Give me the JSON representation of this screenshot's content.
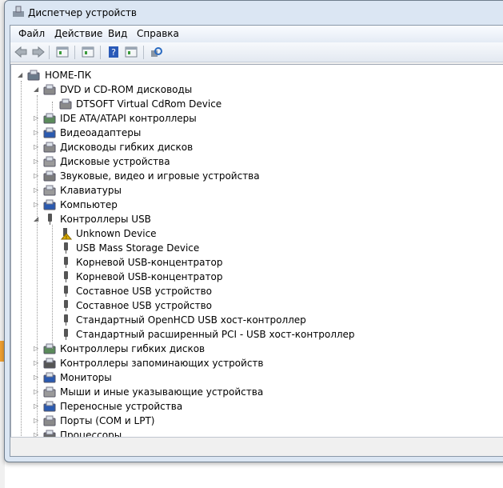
{
  "window": {
    "title": "Диспетчер устройств"
  },
  "menu": [
    "Файл",
    "Действие",
    "Вид",
    "Справка"
  ],
  "toolbar": [
    {
      "icon": "back-arrow-icon"
    },
    {
      "icon": "forward-arrow-icon"
    },
    {
      "icon": "show-hide-console-tree-icon"
    },
    {
      "icon": "properties-icon"
    },
    {
      "icon": "help-icon"
    },
    {
      "icon": "action-pane-icon"
    },
    {
      "icon": "scan-hardware-icon"
    }
  ],
  "tree": [
    {
      "label": "HOME-ПК",
      "level": 0,
      "expanded": true,
      "icon": "computer-icon",
      "color": "#6a7a8a"
    },
    {
      "label": "DVD и CD-ROM дисководы",
      "level": 1,
      "expanded": true,
      "icon": "cdrom-icon",
      "color": "#8a8a8a"
    },
    {
      "label": "DTSOFT Virtual CdRom Device",
      "level": 2,
      "icon": "cdrom-icon",
      "color": "#8a8a8a"
    },
    {
      "label": "IDE ATA/ATAPI контроллеры",
      "level": 1,
      "expanded": false,
      "icon": "ide-controller-icon",
      "color": "#5a8a5a"
    },
    {
      "label": "Видеоадаптеры",
      "level": 1,
      "expanded": false,
      "icon": "display-adapter-icon",
      "color": "#2a5ab0"
    },
    {
      "label": "Дисководы гибких дисков",
      "level": 1,
      "expanded": false,
      "icon": "floppy-drive-icon",
      "color": "#8a8a8a"
    },
    {
      "label": "Дисковые устройства",
      "level": 1,
      "expanded": false,
      "icon": "disk-drive-icon",
      "color": "#9a9a9a"
    },
    {
      "label": "Звуковые, видео и игровые устройства",
      "level": 1,
      "expanded": false,
      "icon": "speaker-icon",
      "color": "#7a7a7a"
    },
    {
      "label": "Клавиатуры",
      "level": 1,
      "expanded": false,
      "icon": "keyboard-icon",
      "color": "#9a9a9a"
    },
    {
      "label": "Компьютер",
      "level": 1,
      "expanded": false,
      "icon": "computer-icon",
      "color": "#2a5ab0"
    },
    {
      "label": "Контроллеры USB",
      "level": 1,
      "expanded": true,
      "icon": "usb-icon",
      "color": "#555555"
    },
    {
      "label": "Unknown Device",
      "level": 2,
      "icon": "usb-warning-icon",
      "color": "#e0b000"
    },
    {
      "label": "USB Mass Storage Device",
      "level": 2,
      "icon": "usb-icon",
      "color": "#555555"
    },
    {
      "label": "Корневой USB-концентратор",
      "level": 2,
      "icon": "usb-icon",
      "color": "#555555"
    },
    {
      "label": "Корневой USB-концентратор",
      "level": 2,
      "icon": "usb-icon",
      "color": "#555555"
    },
    {
      "label": "Составное USB устройство",
      "level": 2,
      "icon": "usb-icon",
      "color": "#555555"
    },
    {
      "label": "Составное USB устройство",
      "level": 2,
      "icon": "usb-icon",
      "color": "#555555"
    },
    {
      "label": "Стандартный OpenHCD USB хост-контроллер",
      "level": 2,
      "icon": "usb-icon",
      "color": "#555555"
    },
    {
      "label": "Стандартный расширенный PCI - USB хост-контроллер",
      "level": 2,
      "icon": "usb-icon",
      "color": "#555555"
    },
    {
      "label": "Контроллеры гибких дисков",
      "level": 1,
      "expanded": false,
      "icon": "floppy-controller-icon",
      "color": "#5a8a5a"
    },
    {
      "label": "Контроллеры запоминающих устройств",
      "level": 1,
      "expanded": false,
      "icon": "storage-controller-icon",
      "color": "#555555"
    },
    {
      "label": "Мониторы",
      "level": 1,
      "expanded": false,
      "icon": "monitor-icon",
      "color": "#2a5ab0"
    },
    {
      "label": "Мыши и иные указывающие устройства",
      "level": 1,
      "expanded": false,
      "icon": "mouse-icon",
      "color": "#9a9a9a"
    },
    {
      "label": "Переносные устройства",
      "level": 1,
      "expanded": false,
      "icon": "portable-device-icon",
      "color": "#2a5ab0"
    },
    {
      "label": "Порты (COM и LPT)",
      "level": 1,
      "expanded": false,
      "icon": "port-icon",
      "color": "#8a8a8a"
    },
    {
      "label": "Процессоры",
      "level": 1,
      "expanded": false,
      "icon": "processor-icon",
      "color": "#6a6a6a"
    }
  ]
}
